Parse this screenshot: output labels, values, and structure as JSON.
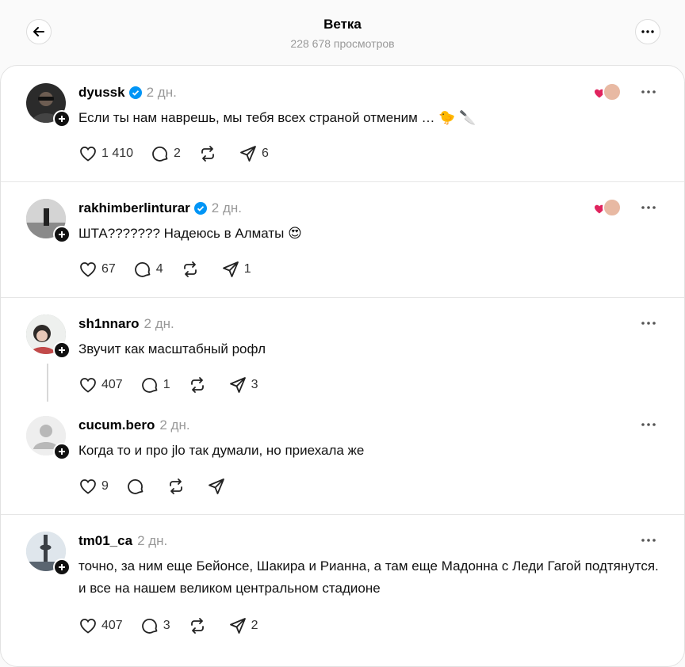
{
  "header": {
    "title": "Ветка",
    "views": "228 678 просмотров"
  },
  "posts": [
    {
      "username": "dyussk",
      "verified": true,
      "time": "2 дн.",
      "text": "Если ты нам наврешь, мы тебя всех страной отменим … 🐤 🔪",
      "likes": "1 410",
      "replies": "2",
      "reposts": "",
      "shares": "6",
      "avatar_color": "#2b2b2b"
    },
    {
      "username": "rakhimberlinturar",
      "verified": true,
      "time": "2 дн.",
      "text": "ШТА??????? Надеюсь в Алматы 😍",
      "likes": "67",
      "replies": "4",
      "reposts": "",
      "shares": "1",
      "avatar_color": "#bdbdbd"
    },
    {
      "username": "sh1nnaro",
      "verified": false,
      "time": "2 дн.",
      "text": "Звучит как масштабный рофл",
      "likes": "407",
      "replies": "1",
      "reposts": "",
      "shares": "3",
      "avatar_color": "#9aa7a0"
    },
    {
      "username": "cucum.bero",
      "verified": false,
      "time": "2 дн.",
      "text": "Когда то и про jlo так думали, но приехала же",
      "likes": "9",
      "replies": "",
      "reposts": "",
      "shares": "",
      "avatar_color": "#e8e8e8"
    },
    {
      "username": "tm01_ca",
      "verified": false,
      "time": "2 дн.",
      "text": "точно, за ним еще Бейонсе, Шакира и Рианна, а там еще Мадонна с Леди Гагой подтянутся. и все на нашем великом центральном стадионе",
      "likes": "407",
      "replies": "3",
      "reposts": "",
      "shares": "2",
      "avatar_color": "#c9d3dc"
    }
  ],
  "colors": {
    "verified_blue": "#0095f6",
    "muted_text": "#999999",
    "reaction_heart": "#e0245e"
  }
}
